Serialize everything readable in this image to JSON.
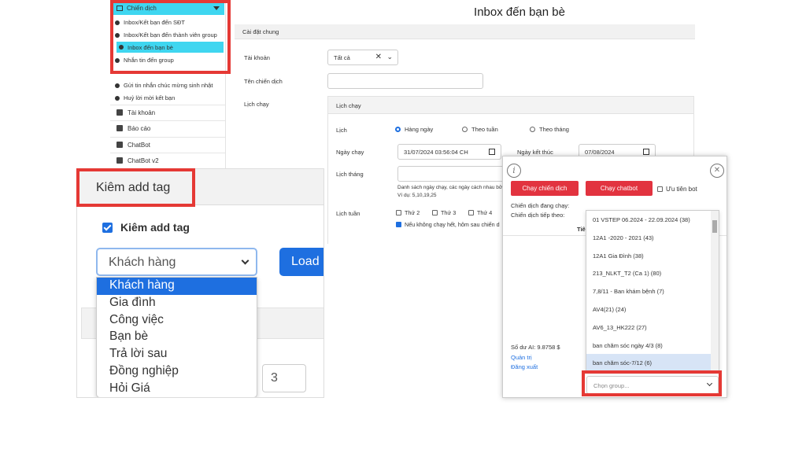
{
  "main": {
    "title": "Inbox đến bạn bè",
    "sidebar": {
      "campaign_header": "Chiến dịch",
      "sub_items": [
        "Inbox/Kết bạn đến SĐT",
        "Inbox/Kết bạn đến thành viên group",
        "Inbox đến bạn bè",
        "Nhắn tin đến group",
        "Gửi tin nhắn chúc mừng sinh nhật",
        "Huỷ lời mời kết bạn"
      ],
      "active_index": 2,
      "main_items": [
        "Tài khoản",
        "Báo cáo",
        "ChatBot",
        "ChatBot v2"
      ]
    },
    "section_title": "Cài đặt chung",
    "form": {
      "account_label": "Tài khoản",
      "account_value": "Tất cả",
      "campaign_name_label": "Tên chiến dịch",
      "campaign_name_value": "",
      "schedule_label": "Lịch chạy"
    },
    "schedule": {
      "box_title": "Lịch chạy",
      "lich_label": "Lịch",
      "options": [
        "Hàng ngày",
        "Theo tuần",
        "Theo tháng"
      ],
      "selected": "Hàng ngày",
      "run_date_label": "Ngày chạy",
      "run_date_value": "31/07/2024 03:56:04 CH",
      "end_date_label": "Ngày kết thúc",
      "end_date_value": "07/08/2024",
      "monthly_label": "Lịch tháng",
      "monthly_hint": "Danh sách ngày chạy, các ngày cách nhau bởi",
      "monthly_example": "Ví dụ: 5,10,19,25",
      "weekly_label": "Lịch tuần",
      "weekdays": [
        "Thứ 2",
        "Thứ 3",
        "Thứ 4"
      ],
      "continue_note": "Nếu không chạy hết, hôm sau chiến d"
    }
  },
  "zoom": {
    "header": "Kiêm add tag",
    "checkbox_label": "Kiêm add tag",
    "checkbox_checked": true,
    "selected_value": "Khách hàng",
    "load_label": "Load",
    "options": [
      "Khách hàng",
      "Gia đình",
      "Công việc",
      "Bạn bè",
      "Trả lời sau",
      "Đồng nghiệp",
      "Hỏi Giá"
    ],
    "background_number": "3"
  },
  "modal": {
    "info_icon_text": "i",
    "run_campaign_label": "Chạy chiến dịch",
    "run_chatbot_label": "Chạy chatbot",
    "priority_bot_label": "Ưu tiên bot",
    "running_label": "Chiến dịch đang chạy:",
    "next_label": "Chiến dịch tiếp theo:",
    "hidden_col_label": "Tiê",
    "balance_label": "Số dư AI: 9.8758 $",
    "admin_link": "Quản trị",
    "logout_link": "Đăng xuất",
    "groups": [
      "01 VSTEP 06.2024 - 22.09.2024 (38)",
      "12A1 -2020 - 2021 (43)",
      "12A1 Gia Đình (38)",
      "213_NLKT_T2 (Ca 1) (80)",
      "7,8/11 - Ban khám bệnh (7)",
      "AV4(21) (24)",
      "AV6_13_HK222 (27)",
      "ban chăm sóc ngày 4/3 (8)",
      "ban chăm sóc-7/12 (6)"
    ],
    "selected_group_index": 8,
    "group_placeholder": "Chọn group..."
  },
  "colors": {
    "accent_cyan": "#3fd6f0",
    "highlight_red": "#e53935",
    "primary_blue": "#1e6fe0",
    "button_red": "#e2333f"
  }
}
